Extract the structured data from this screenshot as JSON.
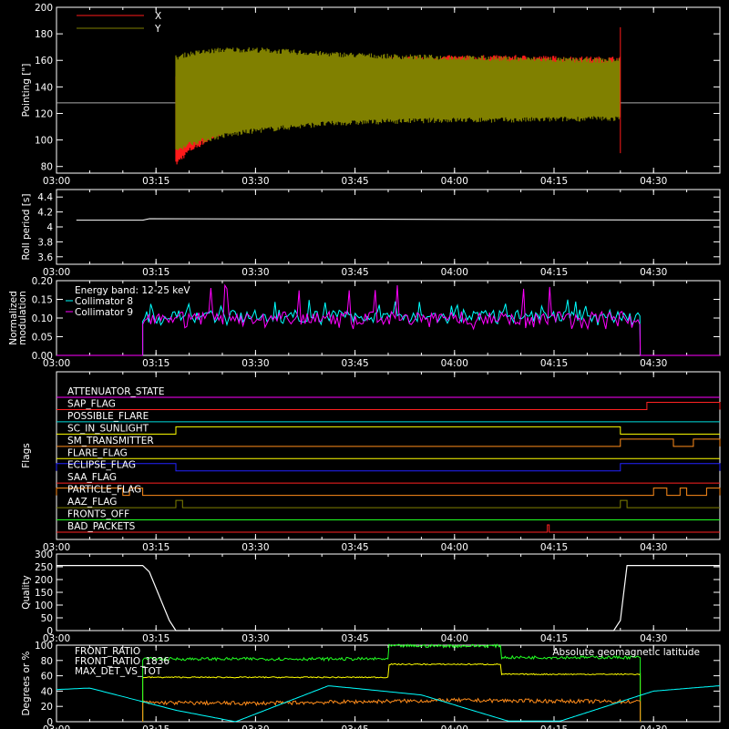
{
  "colors": {
    "background": "#000000",
    "axes": "#ffffff",
    "x_pointing": "#ff1a1a",
    "y_pointing": "#808000",
    "collimator8": "#00ffff",
    "collimator9": "#ff00ff",
    "front_ratio": "#ffff00",
    "front_ratio_1836": "#22ff22",
    "max_det_vs_tot": "#ff8c1a",
    "geomag": "#00ffff"
  },
  "time_axis": {
    "range": [
      "03:00",
      "04:40"
    ],
    "ticks": [
      "03:00",
      "03:15",
      "03:30",
      "03:45",
      "04:00",
      "04:15",
      "04:30"
    ]
  },
  "chart_data": [
    {
      "type": "line",
      "panel": "pointing",
      "ylabel": "Pointing [\"]",
      "ylim": [
        75,
        200
      ],
      "yticks": [
        80,
        100,
        120,
        140,
        160,
        180,
        200
      ],
      "series": [
        {
          "name": "X",
          "color": "#ff1a1a",
          "t_start": "03:18",
          "t_end": "04:25",
          "x": [
            "03:18",
            "03:20",
            "03:25",
            "03:30",
            "03:40",
            "03:50",
            "04:00",
            "04:10",
            "04:20",
            "04:25"
          ],
          "upper": [
            150,
            152,
            155,
            157,
            159,
            161,
            162,
            162,
            161,
            161
          ],
          "lower": [
            82,
            92,
            106,
            112,
            118,
            120,
            121,
            121,
            122,
            122
          ]
        },
        {
          "name": "Y",
          "color": "#808000",
          "t_start": "03:18",
          "t_end": "04:25",
          "x": [
            "03:18",
            "03:20",
            "03:25",
            "03:30",
            "03:40",
            "03:50",
            "04:00",
            "04:10",
            "04:20",
            "04:25"
          ],
          "upper": [
            162,
            165,
            168,
            168,
            165,
            163,
            162,
            161,
            160,
            160
          ],
          "lower": [
            92,
            97,
            103,
            107,
            112,
            114,
            115,
            115,
            116,
            116
          ]
        }
      ],
      "reference_line": 128
    },
    {
      "type": "line",
      "panel": "roll_period",
      "ylabel": "Roll period [s]",
      "ylim": [
        3.5,
        4.5
      ],
      "yticks": [
        3.6,
        3.8,
        4.0,
        4.2,
        4.4
      ],
      "series": [
        {
          "name": "",
          "color": "#ffffff",
          "x": [
            "03:03",
            "03:13",
            "03:14",
            "04:40"
          ],
          "values": [
            4.09,
            4.09,
            4.11,
            4.09
          ]
        }
      ]
    },
    {
      "type": "line",
      "panel": "modulation",
      "ylabel": "Normalized modulation",
      "ylim": [
        0.0,
        0.2
      ],
      "yticks": [
        "0.00",
        "0.05",
        "0.10",
        "0.15",
        "0.20"
      ],
      "annotation": "Energy band: 12-25 keV",
      "series": [
        {
          "name": "Collimator 8",
          "color": "#00ffff",
          "t_start": "03:13",
          "t_end": "04:28",
          "typical": 0.105,
          "spread": [
            0.08,
            0.15
          ]
        },
        {
          "name": "Collimator 9",
          "color": "#ff00ff",
          "t_start": "03:13",
          "t_end": "04:28",
          "typical": 0.1,
          "spread": [
            0.07,
            0.19
          ]
        }
      ]
    },
    {
      "type": "line",
      "panel": "flags",
      "ylabel": "Flags",
      "flags": [
        {
          "name": "ATTENUATOR_STATE",
          "color": "#ff00ff",
          "high": []
        },
        {
          "name": "SAP_FLAG",
          "color": "#ff2222",
          "high": [
            [
              "04:29",
              "04:40"
            ]
          ]
        },
        {
          "name": "POSSIBLE_FLARE",
          "color": "#00dddd",
          "high": []
        },
        {
          "name": "SC_IN_SUNLIGHT",
          "color": "#ffff00",
          "high": [
            [
              "03:18",
              "04:25"
            ]
          ]
        },
        {
          "name": "SM_TRANSMITTER",
          "color": "#ff8c1a",
          "high": [
            [
              "04:25",
              "04:33"
            ],
            [
              "04:36",
              "04:40"
            ]
          ]
        },
        {
          "name": "FLARE_FLAG",
          "color": "#ffff00",
          "high": []
        },
        {
          "name": "ECLIPSE_FLAG",
          "color": "#2222ff",
          "high": [
            [
              "03:00",
              "03:18"
            ],
            [
              "04:25",
              "04:40"
            ]
          ]
        },
        {
          "name": "SAA_FLAG",
          "color": "#ff2222",
          "high": []
        },
        {
          "name": "PARTICLE_FLAG",
          "color": "#ff8c1a",
          "high": [
            [
              "03:00",
              "03:10"
            ],
            [
              "03:11",
              "03:13"
            ],
            [
              "04:30",
              "04:32"
            ],
            [
              "04:34",
              "04:35"
            ],
            [
              "04:38",
              "04:40"
            ]
          ]
        },
        {
          "name": "AAZ_FLAG",
          "color": "#808000",
          "high": [
            [
              "03:18",
              "03:19"
            ],
            [
              "04:25",
              "04:26"
            ]
          ]
        },
        {
          "name": "FRONTS_OFF",
          "color": "#22ff22",
          "high": []
        },
        {
          "name": "BAD_PACKETS",
          "color": "#ff2222",
          "high": [
            [
              "04:14",
              "04:14"
            ]
          ]
        }
      ]
    },
    {
      "type": "line",
      "panel": "quality",
      "ylabel": "Quality",
      "ylim": [
        0,
        300
      ],
      "yticks": [
        0,
        50,
        100,
        150,
        200,
        250,
        300
      ],
      "series": [
        {
          "name": "",
          "color": "#ffffff",
          "x": [
            "03:00",
            "03:13",
            "03:14",
            "03:17",
            "03:18",
            "04:24",
            "04:25",
            "04:26",
            "04:40"
          ],
          "values": [
            255,
            255,
            230,
            40,
            0,
            0,
            40,
            255,
            255
          ]
        }
      ]
    },
    {
      "type": "line",
      "panel": "ratios",
      "ylabel": "Degrees or %",
      "ylim": [
        0,
        100
      ],
      "yticks": [
        0,
        20,
        40,
        60,
        80,
        100
      ],
      "series": [
        {
          "name": "FRONT_RATIO",
          "color": "#ffff00",
          "x": [
            "03:13",
            "03:50",
            "03:50",
            "04:07",
            "04:07",
            "04:28"
          ],
          "values": [
            58,
            58,
            75,
            75,
            62,
            62
          ]
        },
        {
          "name": "FRONT_RATIO_1836",
          "color": "#22ff22",
          "x": [
            "03:13",
            "03:50",
            "03:50",
            "04:07",
            "04:07",
            "04:28"
          ],
          "values": [
            82,
            82,
            99,
            99,
            84,
            84
          ]
        },
        {
          "name": "MAX_DET_VS_TOT",
          "color": "#ff8c1a",
          "x": [
            "03:13",
            "03:30",
            "03:45",
            "04:00",
            "04:15",
            "04:28"
          ],
          "values": [
            25,
            24,
            26,
            28,
            27,
            26
          ]
        },
        {
          "name": "Absolute geomagnetic latitude",
          "color": "#00ffff",
          "x": [
            "03:00",
            "03:05",
            "03:18",
            "03:27",
            "03:41",
            "03:55",
            "04:08",
            "04:16",
            "04:30",
            "04:40"
          ],
          "values": [
            42,
            44,
            15,
            0,
            47,
            35,
            1,
            1,
            40,
            47
          ]
        }
      ]
    }
  ]
}
